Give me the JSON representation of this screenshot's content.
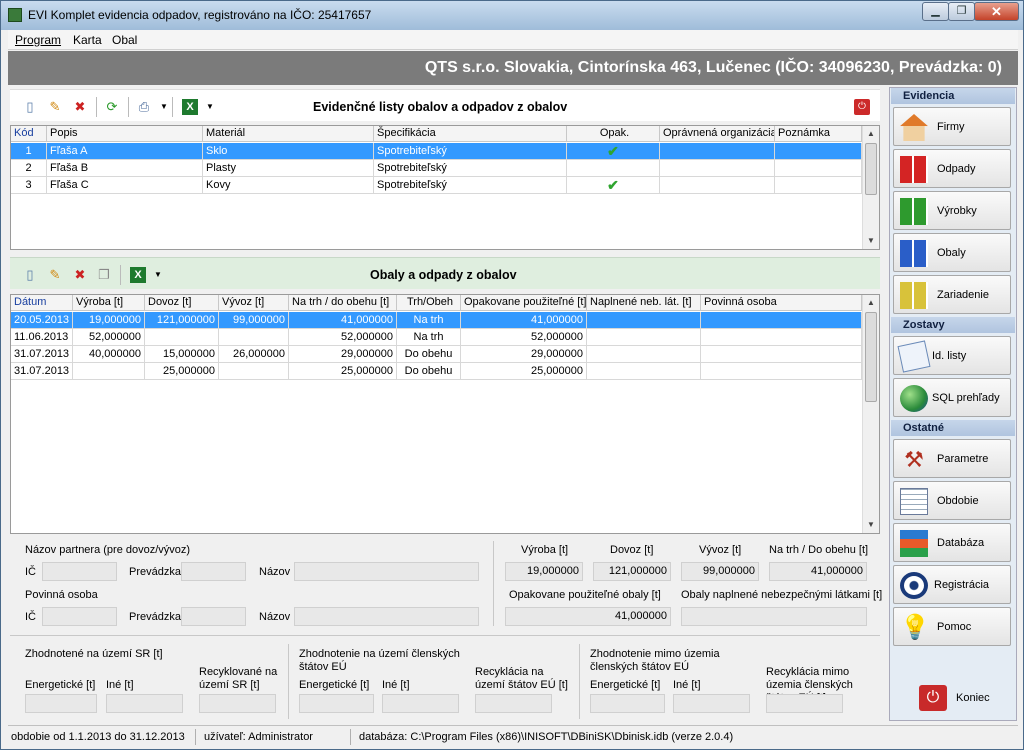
{
  "window": {
    "title": "EVI Komplet  evidencia odpadov, registrováno na IČO: 25417657"
  },
  "menu": {
    "items": [
      "Program",
      "Karta",
      "Obal"
    ]
  },
  "header": {
    "company": "QTS s.r.o. Slovakia, Cintorínska 463, Lučenec (IČO: 34096230, Prevádzka: 0)"
  },
  "top_panel": {
    "title": "Evidenčné listy obalov a odpadov z obalov",
    "columns": [
      "Kód",
      "Popis",
      "Materiál",
      "Špecifikácia",
      "Opak.",
      "Oprávnená organizácia",
      "Poznámka"
    ],
    "rows": [
      {
        "kod": "1",
        "popis": "Fľaša A",
        "material": "Sklo",
        "spec": "Spotrebiteľský",
        "opak": true,
        "org": "",
        "pozn": ""
      },
      {
        "kod": "2",
        "popis": "Fľaša B",
        "material": "Plasty",
        "spec": "Spotrebiteľský",
        "opak": false,
        "org": "",
        "pozn": ""
      },
      {
        "kod": "3",
        "popis": "Fľaša C",
        "material": "Kovy",
        "spec": "Spotrebiteľský",
        "opak": true,
        "org": "",
        "pozn": ""
      }
    ]
  },
  "bottom_panel": {
    "title": "Obaly a odpady z obalov",
    "columns": [
      "Dátum",
      "Výroba [t]",
      "Dovoz [t]",
      "Vývoz [t]",
      "Na trh / do obehu [t]",
      "Trh/Obeh",
      "Opakovane použiteľné [t]",
      "Naplnené neb. lát. [t]",
      "Povinná osoba"
    ],
    "rows": [
      {
        "datum": "20.05.2013",
        "vyroba": "19,000000",
        "dovoz": "121,000000",
        "vyvoz": "99,000000",
        "natrh": "41,000000",
        "trh": "Na trh",
        "opak": "41,000000",
        "napl": "",
        "povinna": ""
      },
      {
        "datum": "11.06.2013",
        "vyroba": "52,000000",
        "dovoz": "",
        "vyvoz": "",
        "natrh": "52,000000",
        "trh": "Na trh",
        "opak": "52,000000",
        "napl": "",
        "povinna": ""
      },
      {
        "datum": "31.07.2013",
        "vyroba": "40,000000",
        "dovoz": "15,000000",
        "vyvoz": "26,000000",
        "natrh": "29,000000",
        "trh": "Do obehu",
        "opak": "29,000000",
        "napl": "",
        "povinna": ""
      },
      {
        "datum": "31.07.2013",
        "vyroba": "",
        "dovoz": "25,000000",
        "vyvoz": "",
        "natrh": "25,000000",
        "trh": "Do obehu",
        "opak": "25,000000",
        "napl": "",
        "povinna": ""
      }
    ]
  },
  "detail": {
    "partner_label": "Názov partnera (pre dovoz/výv​oz)",
    "ic": "IČ",
    "prevadzka": "Prevádzka",
    "nazov": "Názov",
    "povinna_label": "Povinná osoba",
    "vyroba_label": "Výroba [t]",
    "dovoz_label": "Dovoz [t]",
    "vyvoz_label": "Vývoz [t]",
    "natrh_label": "Na trh / Do obehu [t]",
    "vyroba": "19,000000",
    "dovoz": "121,000000",
    "vyvoz": "99,000000",
    "natrh": "41,000000",
    "opak_label": "Opakovane použiteľné obaly [t]",
    "opak": "41,000000",
    "naplnene_label": "Obaly naplnené nebezpečnými látkami [t]"
  },
  "eval": {
    "sr_title": "Zhodnotené na území SR [t]",
    "eu_title": "Zhodnotenie na území členských štátov EÚ",
    "out_title": "Zhodnotenie mimo územia členských štátov EÚ",
    "energ": "Energetické [t]",
    "ine": "Iné [t]",
    "recy_sr": "Recyklované na území SR [t]",
    "recy_eu": "Recyklácia na území štátov EÚ [t]",
    "recy_out": "Recyklácia mimo územia členských štátov EÚ [t]"
  },
  "side": {
    "sections": {
      "evidencia": "Evidencia",
      "zostavy": "Zostavy",
      "ostatne": "Ostatné"
    },
    "buttons": {
      "firmy": "Firmy",
      "odpady": "Odpady",
      "vyrobky": "Výrobky",
      "obaly": "Obaly",
      "zariadenie": "Zariadenie",
      "idlisty": "Id. listy",
      "sql": "SQL prehľady",
      "parametre": "Parametre",
      "obdobie": "Obdobie",
      "databaza": "Databáza",
      "registracia": "Registrácia",
      "pomoc": "Pomoc",
      "koniec": "Koniec"
    }
  },
  "status": {
    "obdobie": "obdobie od 1.1.2013 do 31.12.2013",
    "uzivatel": "užívateľ: Administrator",
    "databaza": "databáza: C:\\Program Files (x86)\\INISOFT\\DBiniSK\\Dbinisk.idb  (verze 2.0.4)"
  },
  "colors": {
    "accent": "#3399ff",
    "panel_header": "#dfeedf",
    "company_bar": "#7b7b7b"
  },
  "icons": [
    "new-icon",
    "edit-icon",
    "delete-icon",
    "refresh-icon",
    "print-icon",
    "excel-icon",
    "close-panel-icon",
    "checkmark-icon"
  ]
}
